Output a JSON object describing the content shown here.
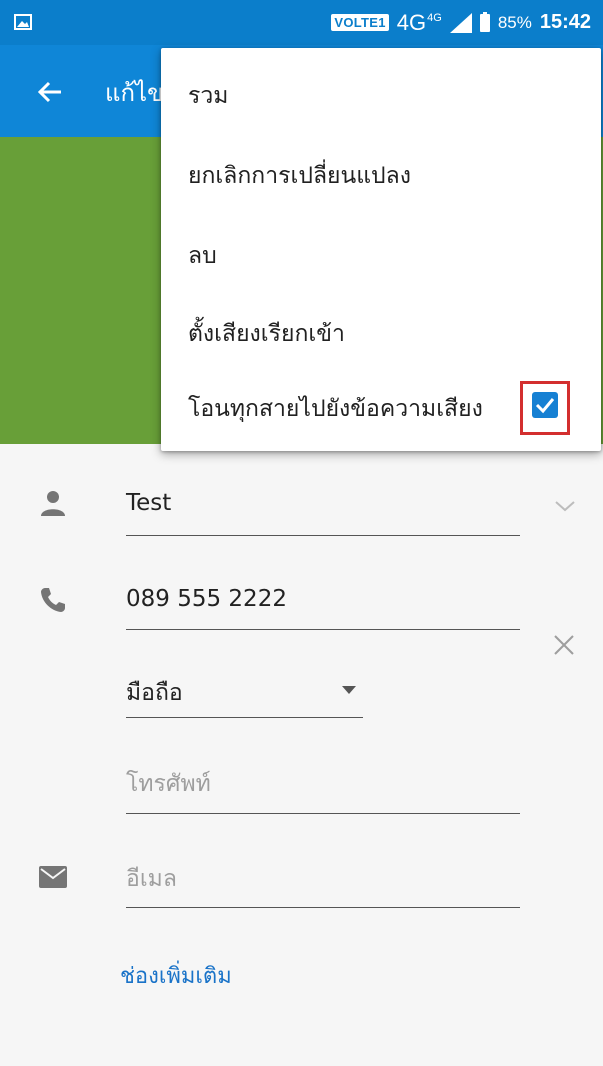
{
  "status_bar": {
    "volte": "VOLTE1",
    "network": "4G",
    "network_super": "4G",
    "battery": "85%",
    "time": "15:42"
  },
  "app_bar": {
    "title": "แก้ไข"
  },
  "form": {
    "name_value": "Test",
    "phone_value": "089 555 2222",
    "phone_type": "มือถือ",
    "phone_placeholder": "โทรศัพท์",
    "email_placeholder": "อีเมล",
    "more_fields": "ช่องเพิ่มเติม"
  },
  "menu": {
    "items": [
      {
        "label": "รวม"
      },
      {
        "label": "ยกเลิกการเปลี่ยนแปลง"
      },
      {
        "label": "ลบ"
      },
      {
        "label": "ตั้งเสียงเรียกเข้า"
      },
      {
        "label": "โอนทุกสายไปยังข้อความเสียง",
        "checked": true
      }
    ]
  },
  "colors": {
    "status_bar": "#0b7ecb",
    "app_bar": "#0f86d7",
    "photo_area": "#689f38",
    "accent": "#1680d3",
    "highlight": "#d32f2f"
  },
  "icons": [
    "image-icon",
    "signal-icon",
    "battery-icon",
    "back-arrow-icon",
    "person-icon",
    "phone-icon",
    "email-icon",
    "chevron-down-icon",
    "close-icon",
    "dropdown-arrow-icon",
    "checkmark-icon"
  ]
}
